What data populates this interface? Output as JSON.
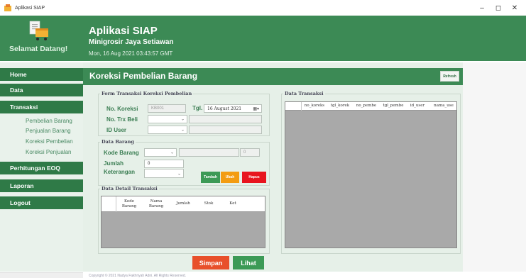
{
  "window": {
    "title": "Aplikasi SIAP",
    "minimize": "–",
    "maximize": "◻",
    "close": "✕"
  },
  "header": {
    "welcome": "Selamat Datang!",
    "app_title": "Aplikasi SIAP",
    "store_name": "Minigrosir Jaya Setiawan",
    "datetime": "Mon, 16 Aug 2021 03:43:57 GMT"
  },
  "sidebar": {
    "menus": [
      "Home",
      "Data",
      "Transaksi",
      "Perhitungan EOQ",
      "Laporan",
      "Logout"
    ],
    "submenus": [
      "Pembelian Barang",
      "Penjualan Barang",
      "Koreksi Pembelian",
      "Koreksi Penjualan"
    ]
  },
  "page": {
    "title": "Koreksi Pembelian Barang",
    "refresh": "Refresh"
  },
  "form": {
    "group_title": "Form Transaksi Koreksi Pembelian",
    "no_koreksi_label": "No. Koreksi",
    "no_koreksi_value": "KB001",
    "tgl_label": "Tgl.",
    "tgl_value": "16  August  2021",
    "no_trx_label": "No. Trx Beli",
    "id_user_label": "ID User"
  },
  "barang": {
    "group_title": "Data Barang",
    "kode_label": "Kode Barang",
    "qty_value": "0",
    "jumlah_label": "Jumlah",
    "jumlah_value": "0",
    "ket_label": "Keterangan",
    "tambah": "Tambah",
    "ubah": "Ubah",
    "hapus": "Hapus"
  },
  "detail": {
    "group_title": "Data Detail Transaksi",
    "columns": [
      "Kode Barang",
      "Nama Barang",
      "Jumlah",
      "Stok",
      "Ket"
    ]
  },
  "transaksi": {
    "group_title": "Data Transaksi",
    "columns": [
      "no_koreks",
      "tgl_korek",
      "no_pembe",
      "tgl_pembe",
      "id_user",
      "nama_use"
    ]
  },
  "actions": {
    "simpan": "Simpan",
    "lihat": "Lihat"
  },
  "footer": "Copyright © 2021 Nadya Fakhriyah Adni. All Rights Reserved.",
  "colors": {
    "header": "#3c8a55",
    "menu": "#2f7a47",
    "simpan": "#e8502b",
    "lihat": "#3c9a56",
    "tambah": "#3c9a56",
    "ubah": "#f39c12",
    "hapus": "#e8141e"
  }
}
